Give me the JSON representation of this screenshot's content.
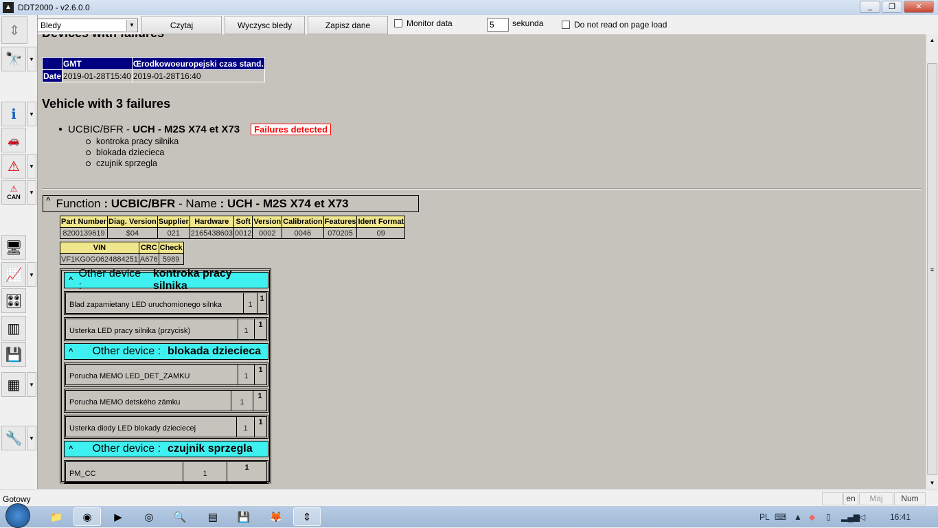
{
  "window": {
    "title": "DDT2000 - v2.6.0.0",
    "minimize": "_",
    "maximize": "❐",
    "close": "✕"
  },
  "toolbar": {
    "mode_select": "Bledy",
    "read_label": "Czytaj",
    "clear_label": "Wyczysc bledy",
    "save_label": "Zapisz dane",
    "monitor_label": "Monitor data",
    "seconds_value": "5",
    "seconds_label": "sekunda",
    "no_read_label": "Do not read on page load"
  },
  "sidebar": {
    "can_label": "CAN"
  },
  "report": {
    "devices_heading": "Devices with failures",
    "date_table": {
      "headers": [
        "",
        "GMT",
        "Œrodkowoeuropejski czas stand."
      ],
      "row_label": "Date",
      "values": [
        "2019-01-28T15:40",
        "2019-01-28T16:40"
      ]
    },
    "vehicle_heading": "Vehicle with 3 failures",
    "ecu": {
      "function": "UCBIC/BFR",
      "separator": " - ",
      "name": "UCH - M2S X74 et X73",
      "badge": "Failures detected"
    },
    "failures_list": [
      "kontroka pracy silnika",
      "blokada dziecieca",
      "czujnik sprzegla"
    ],
    "function_box": {
      "caret": "^",
      "function_label": "Function",
      "colon": ":",
      "function_value": "UCBIC/BFR",
      "dash": "-",
      "name_label": "Name",
      "name_value_a": "UCH -",
      "name_value_b": "M2S X74 et X73"
    },
    "ident_table": {
      "headers": [
        "Part Number",
        "Diag. Version",
        "Supplier",
        "Hardware",
        "Soft",
        "Version",
        "Calibration",
        "Features",
        "Ident Format"
      ],
      "values": [
        "8200139619",
        "$04",
        "021",
        "2165438603",
        "0012",
        "0002",
        "0046",
        "070205",
        "09"
      ]
    },
    "vin_table": {
      "headers": [
        "VIN",
        "CRC",
        "Check"
      ],
      "values": [
        "VF1KG0G0624884251",
        "A676",
        "5989"
      ]
    },
    "devices": [
      {
        "caret": "^",
        "label": "Other device :",
        "name": "kontroka pracy silnika",
        "faults": [
          {
            "text": "Blad zapamietany LED uruchomionego silnka",
            "count": "1",
            "flag": "1"
          },
          {
            "text": "Usterka LED pracy silnika (przycisk)",
            "count": "1",
            "flag": "1"
          }
        ]
      },
      {
        "caret": "^",
        "label": "Other device :",
        "name": "blokada dziecieca",
        "faults": [
          {
            "text": "Porucha MEMO LED_DET_ZAMKU",
            "count": "1",
            "flag": "1"
          },
          {
            "text": "Porucha MEMO detského zámku",
            "count": "1",
            "flag": "1"
          },
          {
            "text": "Usterka diody LED blokady dzieciecej",
            "count": "1",
            "flag": "1"
          }
        ]
      },
      {
        "caret": "^",
        "label": "Other device :",
        "name": "czujnik sprzegla",
        "faults": [
          {
            "text": "PM_CC",
            "count": "1",
            "flag": "1"
          }
        ]
      }
    ]
  },
  "statusbar": {
    "status": "Gotowy",
    "lang": "en",
    "caps": "Maj",
    "num": "Num"
  },
  "taskbar": {
    "lang": "PL",
    "time": "16:41"
  }
}
